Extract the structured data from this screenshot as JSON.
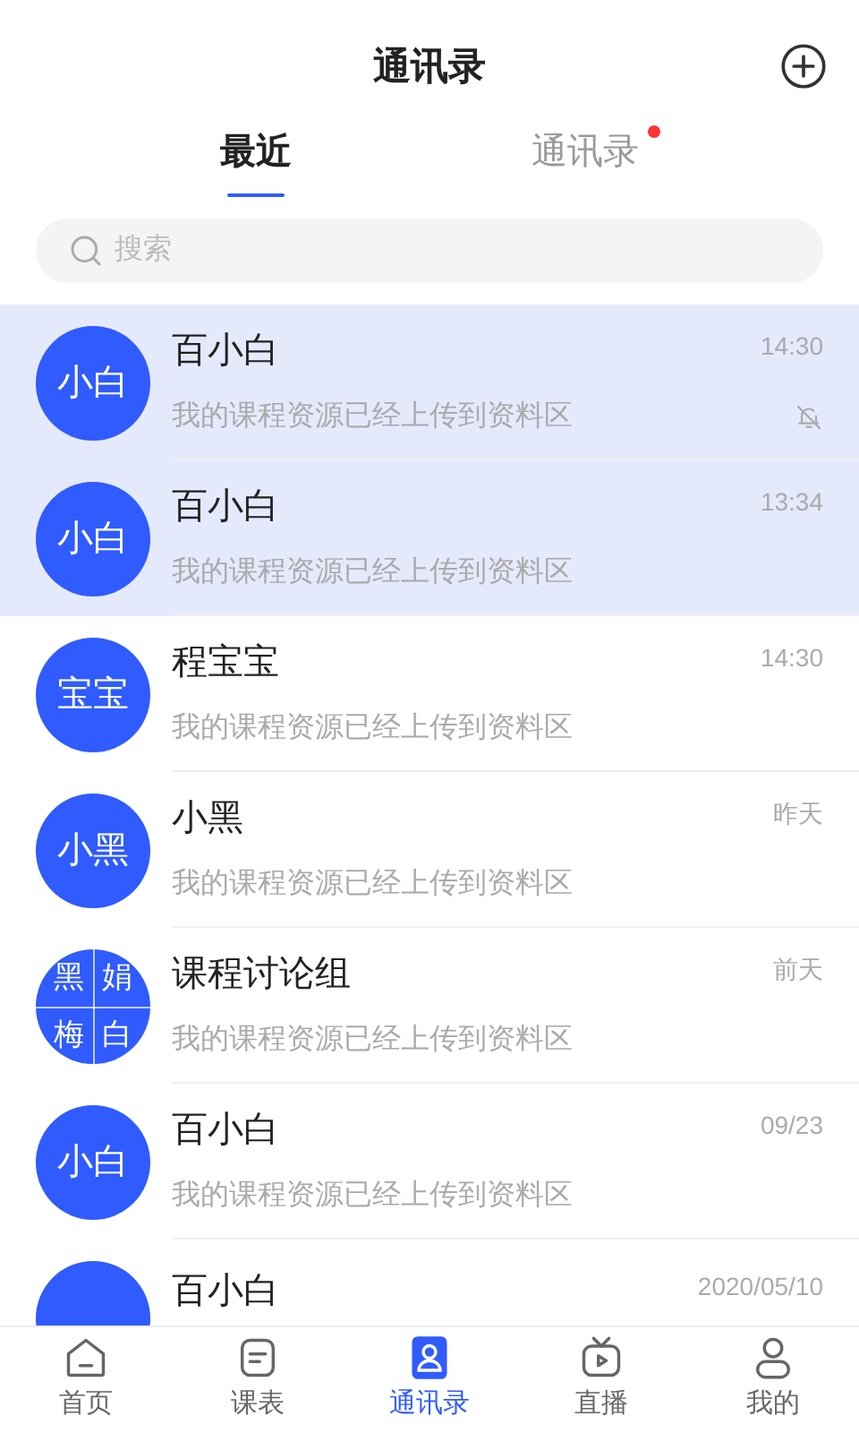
{
  "header": {
    "title": "通讯录"
  },
  "tabs": [
    {
      "label": "最近",
      "selected": true,
      "badge": false
    },
    {
      "label": "通讯录",
      "selected": false,
      "badge": true
    }
  ],
  "search": {
    "placeholder": "搜索"
  },
  "conversations": [
    {
      "kind": "single",
      "avatar_text": "小白",
      "name": "百小白",
      "time": "14:30",
      "message": "我的课程资源已经上传到资料区",
      "pinned": true,
      "muted": true
    },
    {
      "kind": "single",
      "avatar_text": "小白",
      "name": "百小白",
      "time": "13:34",
      "message": "我的课程资源已经上传到资料区",
      "pinned": true,
      "muted": false
    },
    {
      "kind": "single",
      "avatar_text": "宝宝",
      "name": "程宝宝",
      "time": "14:30",
      "message": "我的课程资源已经上传到资料区",
      "pinned": false,
      "muted": false
    },
    {
      "kind": "single",
      "avatar_text": "小黑",
      "name": "小黑",
      "time": "昨天",
      "message": "我的课程资源已经上传到资料区",
      "pinned": false,
      "muted": false
    },
    {
      "kind": "group",
      "avatar_chars": [
        "黑",
        "娟",
        "梅",
        "白"
      ],
      "name": "课程讨论组",
      "time": "前天",
      "message": "我的课程资源已经上传到资料区",
      "pinned": false,
      "muted": false
    },
    {
      "kind": "single",
      "avatar_text": "小白",
      "name": "百小白",
      "time": "09/23",
      "message": "我的课程资源已经上传到资料区",
      "pinned": false,
      "muted": false
    },
    {
      "kind": "single",
      "name": "百小白",
      "time": "2020/05/10",
      "pinned": false
    }
  ],
  "bottom_nav": [
    {
      "label": "首页",
      "selected": false
    },
    {
      "label": "课表",
      "selected": false
    },
    {
      "label": "通讯录",
      "selected": true
    },
    {
      "label": "直播",
      "selected": false
    },
    {
      "label": "我的",
      "selected": false
    }
  ]
}
